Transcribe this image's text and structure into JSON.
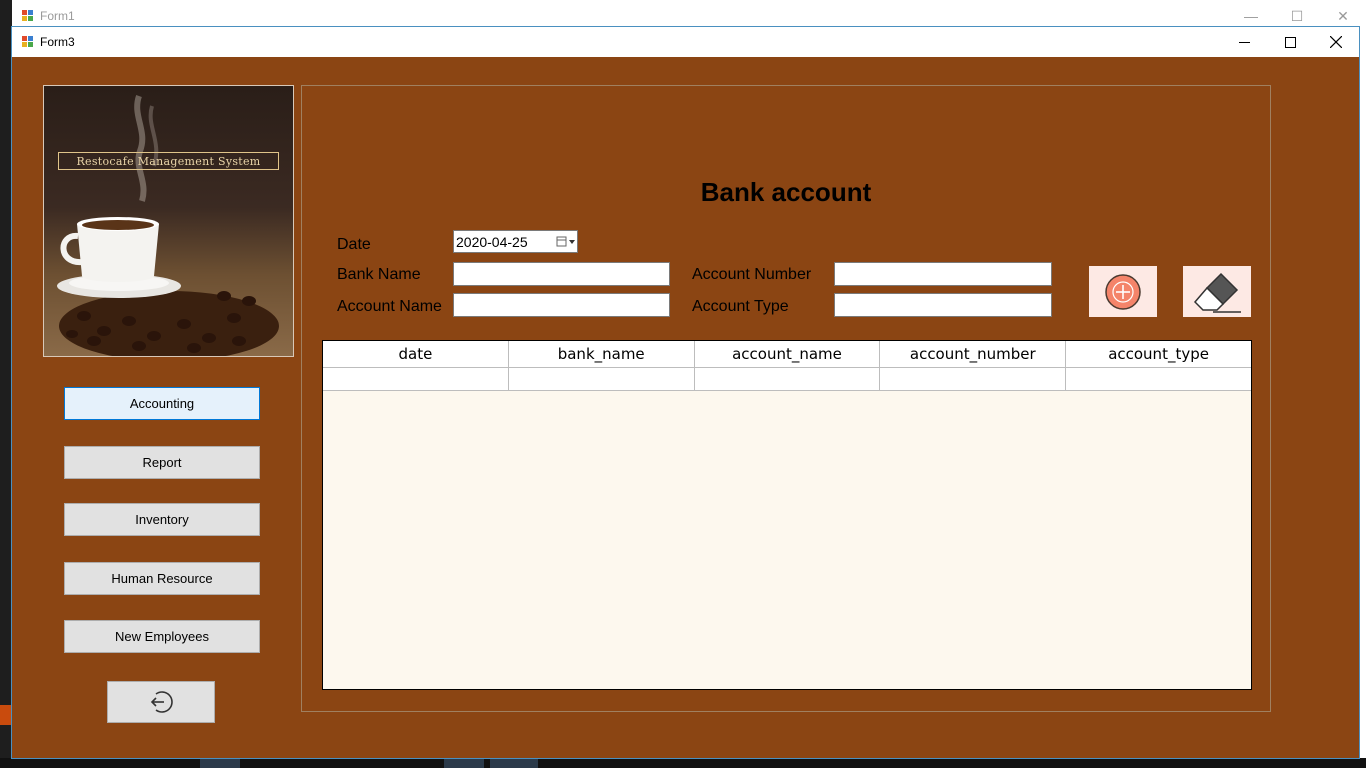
{
  "background_window": {
    "title": "Form1"
  },
  "window": {
    "title": "Form3",
    "controls": [
      "minimize-icon",
      "maximize-icon",
      "close-icon"
    ]
  },
  "logo": {
    "banner_text": "Restocafe Management System"
  },
  "nav": {
    "accounting": "Accounting",
    "report": "Report",
    "inventory": "Inventory",
    "human_resource": "Human Resource",
    "new_employees": "New Employees",
    "logout_icon": "logout-icon"
  },
  "form": {
    "title": "Bank account",
    "date_label": "Date",
    "date_value": "2020-04-25",
    "bank_name_label": "Bank Name",
    "bank_name_value": "",
    "account_name_label": "Account Name",
    "account_name_value": "",
    "account_number_label": "Account Number",
    "account_number_value": "",
    "account_type_label": "Account Type",
    "account_type_value": "",
    "add_icon": "add-icon",
    "clear_icon": "eraser-icon"
  },
  "grid": {
    "columns": [
      "date",
      "bank_name",
      "account_name",
      "account_number",
      "account_type"
    ],
    "rows": [
      [
        "",
        "",
        "",
        "",
        ""
      ]
    ]
  },
  "colors": {
    "form_background": "#8b4513",
    "grid_background": "#fdf8ee",
    "active_button": "#e5f1fb",
    "action_button": "#fde9e4"
  }
}
